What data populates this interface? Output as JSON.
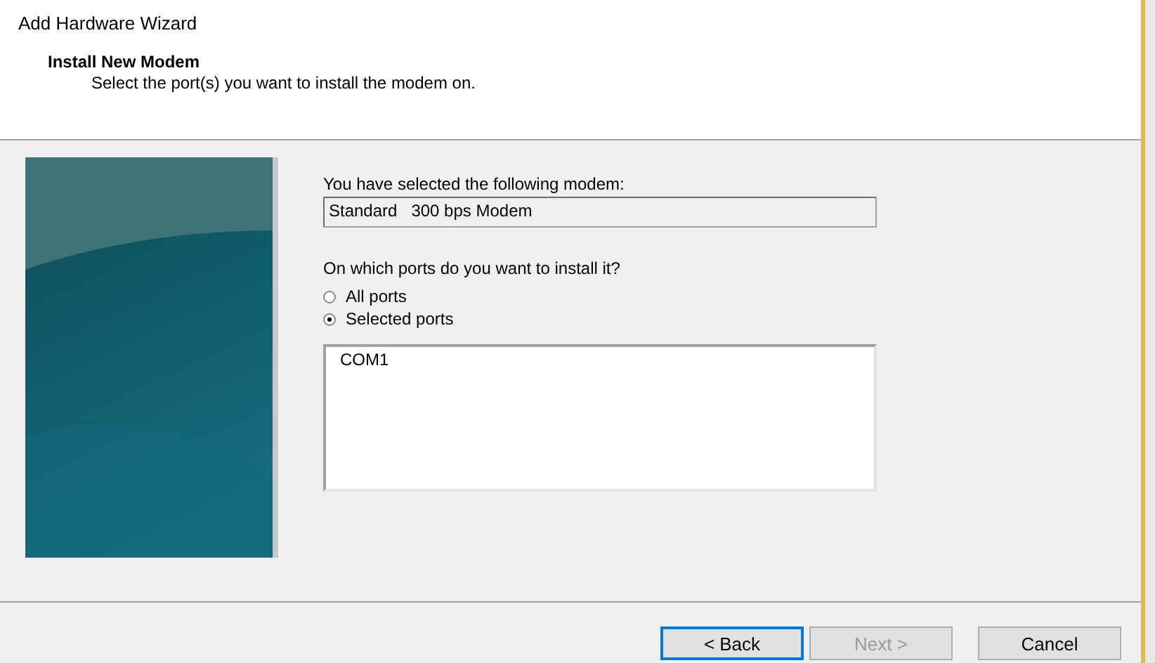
{
  "window": {
    "title": "Add Hardware Wizard"
  },
  "header": {
    "title": "Install New Modem",
    "subtitle": "Select the port(s) you want to install the modem on."
  },
  "modem": {
    "label": "You have selected the following modem:",
    "value": "Standard   300 bps Modem"
  },
  "ports": {
    "question": "On which ports do you want to install it?",
    "options": [
      {
        "label": "All ports",
        "selected": false
      },
      {
        "label": "Selected ports",
        "selected": true
      }
    ],
    "list": [
      {
        "label": "COM1",
        "selected": false
      }
    ]
  },
  "buttons": [
    {
      "label": "< Back",
      "focused": true,
      "disabled": false
    },
    {
      "label": "Next >",
      "focused": false,
      "disabled": true
    },
    {
      "label": "Cancel",
      "focused": false,
      "disabled": false
    }
  ]
}
